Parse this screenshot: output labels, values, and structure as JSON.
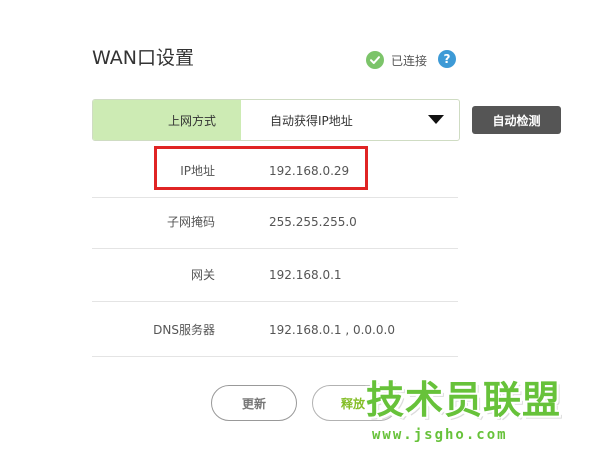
{
  "header": {
    "title": "WAN口设置",
    "status_text": "已连接",
    "help_glyph": "?"
  },
  "connection": {
    "mode_label": "上网方式",
    "mode_value": "自动获得IP地址",
    "auto_detect_label": "自动检测"
  },
  "info_rows": [
    {
      "label": "IP地址",
      "value": "192.168.0.29"
    },
    {
      "label": "子网掩码",
      "value": "255.255.255.0"
    },
    {
      "label": "网关",
      "value": "192.168.0.1"
    },
    {
      "label": "DNS服务器",
      "value": "192.168.0.1 , 0.0.0.0"
    }
  ],
  "actions": {
    "renew_label": "更新",
    "release_label": "释放"
  },
  "watermark": {
    "title": "技术员联盟",
    "url": "www.jsgho.com"
  },
  "colors": {
    "accent_green": "#67c23a",
    "status_green": "#7cc46a",
    "label_cell_bg": "#cdebb4",
    "help_blue": "#3d9ad6",
    "highlight_red": "#e02424",
    "detect_button_bg": "#555555"
  },
  "icons": {
    "status": "check-circle-icon",
    "help": "question-circle-icon",
    "dropdown": "triangle-down-icon"
  }
}
